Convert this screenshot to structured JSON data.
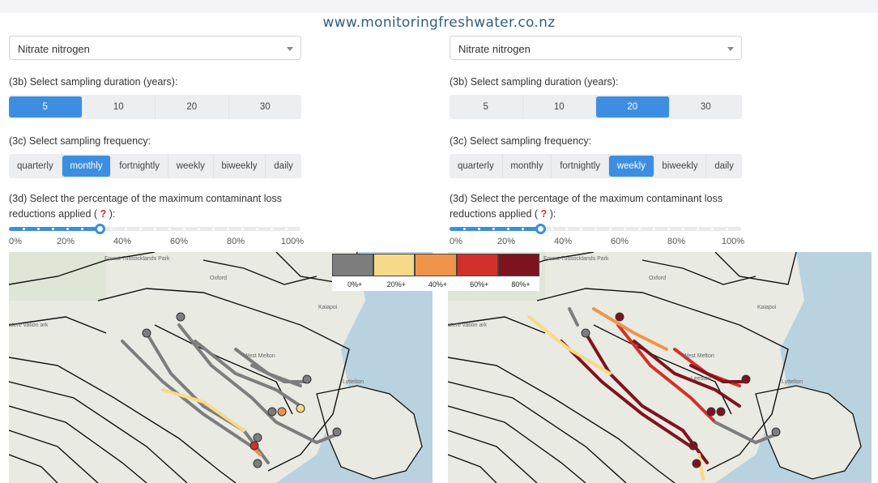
{
  "site_url": "www.monitoringfreshwater.co.nz",
  "panels": {
    "left": {
      "contaminant": "Nitrate nitrogen",
      "duration_label": "(3b) Select sampling duration (years):",
      "duration_options": [
        "5",
        "10",
        "20",
        "30"
      ],
      "duration_selected": "5",
      "frequency_label": "(3c) Select sampling frequency:",
      "frequency_options": [
        "quarterly",
        "monthly",
        "fortnightly",
        "weekly",
        "biweekly",
        "daily"
      ],
      "frequency_selected": "monthly",
      "reduction_label": "(3d) Select the percentage of the maximum contaminant loss reductions applied (",
      "reduction_label_qmark": "?",
      "reduction_label_end": "):",
      "reduction_ticks": [
        "0%",
        "20%",
        "40%",
        "60%",
        "80%",
        "100%"
      ],
      "reduction_value_percent": 31
    },
    "right": {
      "contaminant": "Nitrate nitrogen",
      "duration_label": "(3b) Select sampling duration (years):",
      "duration_options": [
        "5",
        "10",
        "20",
        "30"
      ],
      "duration_selected": "20",
      "frequency_label": "(3c) Select sampling frequency:",
      "frequency_options": [
        "quarterly",
        "monthly",
        "fortnightly",
        "weekly",
        "biweekly",
        "daily"
      ],
      "frequency_selected": "weekly",
      "reduction_label": "(3d) Select the percentage of the maximum contaminant loss reductions applied (",
      "reduction_label_qmark": "?",
      "reduction_label_end": "):",
      "reduction_ticks": [
        "0%",
        "20%",
        "40%",
        "60%",
        "80%",
        "100%"
      ],
      "reduction_value_percent": 31
    }
  },
  "legend": {
    "labels": [
      "0%+",
      "20%+",
      "40%+",
      "60%+",
      "80%+"
    ],
    "colors": [
      "#7d7d7d",
      "#f7d98a",
      "#f0944a",
      "#d1312a",
      "#7e1320"
    ]
  },
  "map_labels": {
    "park": "Forest Tussocklands Park",
    "oxford": "Oxford",
    "kaiapoi": "Kaiapoi",
    "reserve": "atere vation ark",
    "west_melton": "West Melton",
    "lyttelton": "Lyttelton",
    "leeston": "Leeston"
  },
  "colors": {
    "accent": "#3d8ee0",
    "url": "#2f5e7f",
    "sea": "#b9d2df",
    "land": "#e9eae2"
  }
}
